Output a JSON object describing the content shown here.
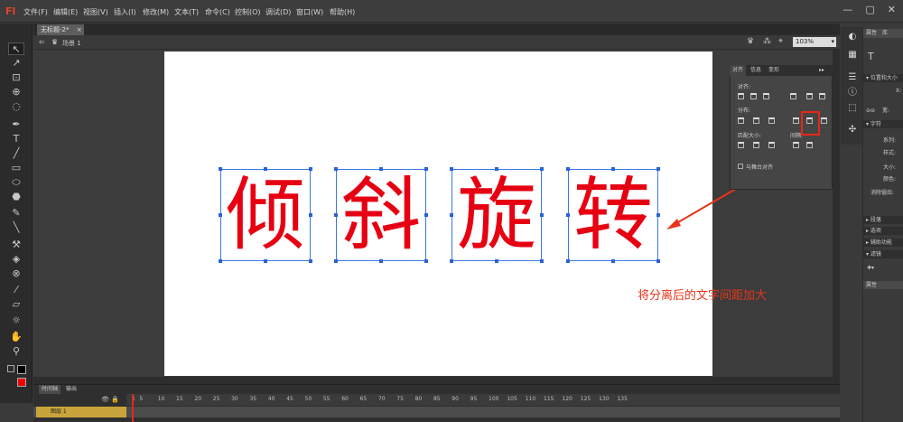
{
  "app": {
    "logo": "Fl",
    "window_controls": [
      "—",
      "▢",
      "✕"
    ]
  },
  "menu": [
    "文件(F)",
    "编辑(E)",
    "视图(V)",
    "插入(I)",
    "修改(M)",
    "文本(T)",
    "命令(C)",
    "控制(O)",
    "调试(D)",
    "窗口(W)",
    "帮助(H)"
  ],
  "document": {
    "tab": "无标题-2*",
    "close": "×",
    "scene": "场景 1",
    "zoom": "103%"
  },
  "stage": {
    "chars": [
      "倾",
      "斜",
      "旋",
      "转"
    ],
    "text_color": "#e60012"
  },
  "annotation": {
    "text": "将分离后的文字间距加大",
    "color": "#e8341a"
  },
  "align_panel": {
    "tabs": [
      "对齐",
      "信息",
      "变形"
    ],
    "align_label": "对齐:",
    "distribute_label": "分布:",
    "match_size_label": "匹配大小:",
    "spacing_label": "间隔:",
    "stage_checkbox": "与舞台对齐"
  },
  "properties_panel": {
    "tabs": [
      "属性",
      "库"
    ],
    "section_position": "位置和大小",
    "x_label": "X:",
    "w_label": "宽:",
    "section_char": "字符",
    "family": "系列:",
    "style": "样式:",
    "size": "大小:",
    "color": "颜色:",
    "aa": "消除锯齿:",
    "para": "段落",
    "options": "选项",
    "access": "辅助功能",
    "filters": "滤镜",
    "props_footer": "属性"
  },
  "timeline": {
    "tabs": [
      "时间轴",
      "输出"
    ],
    "layer": "图层 1",
    "frames": [
      "1",
      "5",
      "10",
      "15",
      "20",
      "25",
      "30",
      "35",
      "40",
      "45",
      "50",
      "55",
      "60",
      "65",
      "70",
      "75",
      "80",
      "85",
      "90",
      "95",
      "100",
      "105",
      "110",
      "115",
      "120",
      "125",
      "130",
      "135"
    ]
  }
}
